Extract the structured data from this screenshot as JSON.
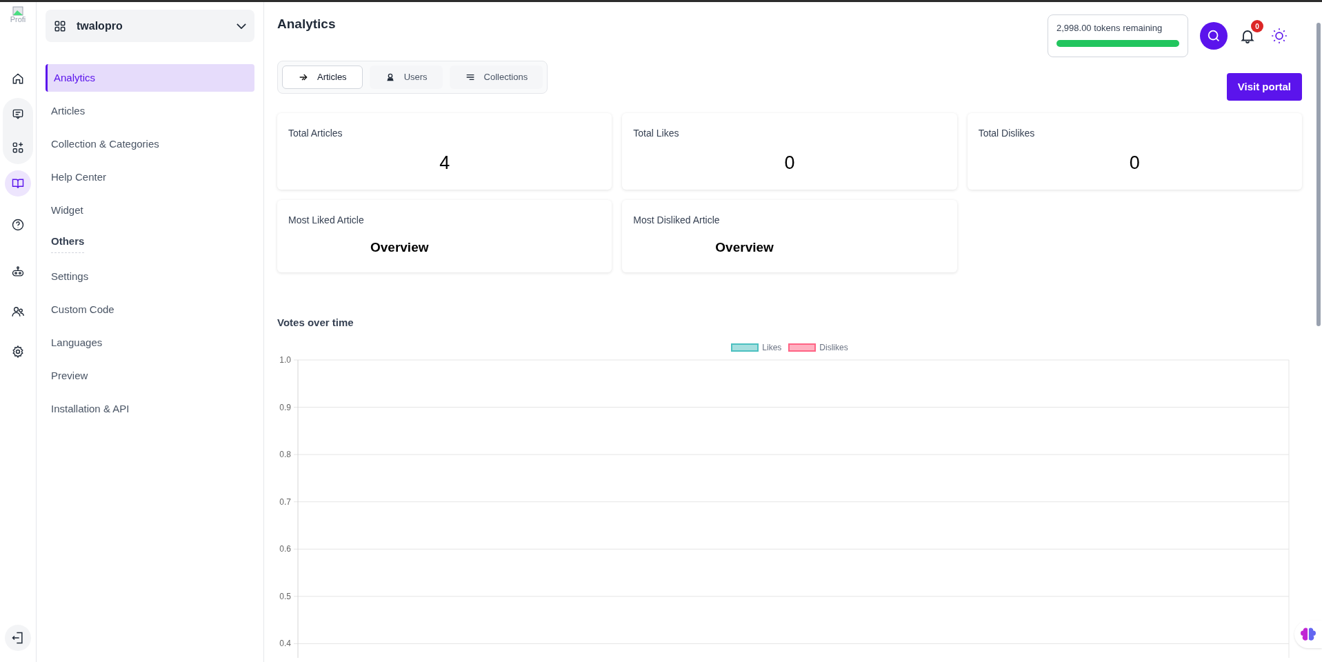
{
  "logo": {
    "alt_text": "Profi"
  },
  "rail": [
    {
      "kind": "home",
      "selected": false
    },
    {
      "kind": "chat",
      "selected": false
    },
    {
      "kind": "apps",
      "selected": false
    },
    {
      "kind": "book",
      "selected": true
    },
    {
      "kind": "help",
      "selected": false
    },
    {
      "kind": "robot",
      "selected": false
    },
    {
      "kind": "users",
      "selected": false
    },
    {
      "kind": "gear",
      "selected": false
    }
  ],
  "workspace": {
    "name": "twalopro"
  },
  "nav": [
    {
      "kind": "item",
      "label": "Analytics",
      "selected": true
    },
    {
      "kind": "item",
      "label": "Articles",
      "selected": false
    },
    {
      "kind": "item",
      "label": "Collection & Categories",
      "selected": false
    },
    {
      "kind": "item",
      "label": "Help Center",
      "selected": false
    },
    {
      "kind": "item",
      "label": "Widget",
      "selected": false
    },
    {
      "kind": "heading",
      "label": "Others"
    },
    {
      "kind": "item",
      "label": "Settings",
      "selected": false
    },
    {
      "kind": "item",
      "label": "Custom Code",
      "selected": false
    },
    {
      "kind": "item",
      "label": "Languages",
      "selected": false
    },
    {
      "kind": "item",
      "label": "Preview",
      "selected": false
    },
    {
      "kind": "item",
      "label": "Installation & API",
      "selected": false
    }
  ],
  "page": {
    "title": "Analytics"
  },
  "tokens": {
    "text": "2,998.00 tokens remaining",
    "level": 1.0
  },
  "notifications": {
    "count": "0"
  },
  "tabs": [
    {
      "kind": "articles",
      "label": "Articles",
      "selected": true
    },
    {
      "kind": "users",
      "label": "Users",
      "selected": false
    },
    {
      "kind": "collections",
      "label": "Collections",
      "selected": false
    }
  ],
  "visit_button": "Visit portal",
  "stats": [
    {
      "label": "Total Articles",
      "value": "4",
      "kind": "number"
    },
    {
      "label": "Total Likes",
      "value": "0",
      "kind": "number"
    },
    {
      "label": "Total Dislikes",
      "value": "0",
      "kind": "number"
    },
    {
      "label": "Most Liked Article",
      "value": "Overview",
      "kind": "article"
    },
    {
      "label": "Most Disliked Article",
      "value": "Overview",
      "kind": "article"
    }
  ],
  "chart": {
    "title": "Votes over time",
    "chart_data": {
      "type": "bar",
      "ylim": [
        0.37,
        1.0
      ],
      "grid": true,
      "yticks": [
        {
          "value": 1.0,
          "label": "1.0"
        },
        {
          "value": 0.9,
          "label": "0.9"
        },
        {
          "value": 0.8,
          "label": "0.8"
        },
        {
          "value": 0.7,
          "label": "0.7"
        },
        {
          "value": 0.6,
          "label": "0.6"
        },
        {
          "value": 0.5,
          "label": "0.5"
        },
        {
          "value": 0.4,
          "label": "0.4"
        }
      ],
      "series": [
        {
          "name": "Likes",
          "color": "#4bc0c0"
        },
        {
          "name": "Dislikes",
          "color": "#ff6384"
        }
      ]
    }
  }
}
